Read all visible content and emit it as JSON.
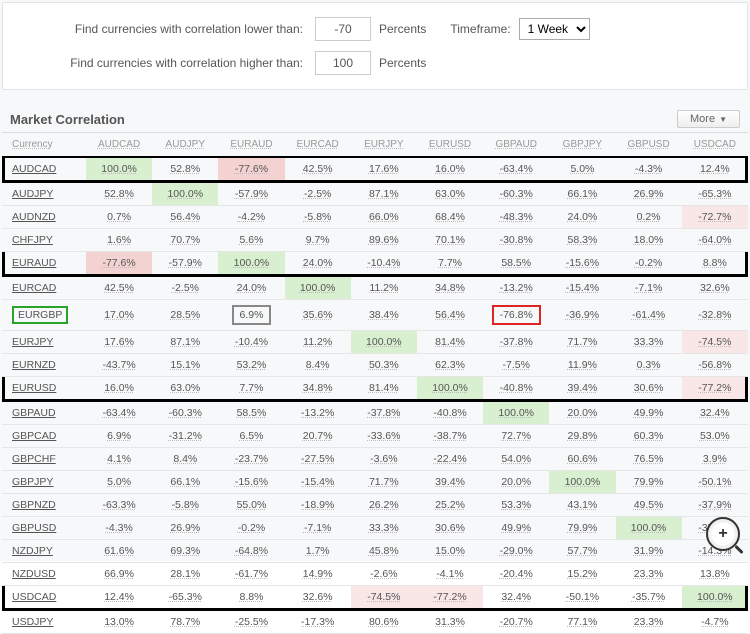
{
  "filters": {
    "lower_label": "Find currencies with correlation lower than:",
    "lower_value": "-70",
    "higher_label": "Find currencies with correlation higher than:",
    "higher_value": "100",
    "percents": "Percents",
    "timeframe_label": "Timeframe:",
    "timeframe_value": "1 Week"
  },
  "section": {
    "title": "Market Correlation",
    "more": "More"
  },
  "columns": [
    "Currency",
    "AUDCAD",
    "AUDJPY",
    "EURAUD",
    "EURCAD",
    "EURJPY",
    "EURUSD",
    "GBPAUD",
    "GBPJPY",
    "GBPUSD",
    "USDCAD"
  ],
  "rows": [
    {
      "sym": "AUDCAD",
      "black_row": true,
      "c": [
        {
          "v": "100.0%",
          "hl": "g"
        },
        {
          "v": "52.8%"
        },
        {
          "v": "-77.6%",
          "hl": "r"
        },
        {
          "v": "42.5%"
        },
        {
          "v": "17.6%"
        },
        {
          "v": "16.0%"
        },
        {
          "v": "-63.4%"
        },
        {
          "v": "5.0%"
        },
        {
          "v": "-4.3%"
        },
        {
          "v": "12.4%"
        }
      ]
    },
    {
      "sym": "AUDJPY",
      "c": [
        {
          "v": "52.8%"
        },
        {
          "v": "100.0%",
          "hl": "g"
        },
        {
          "v": "-57.9%"
        },
        {
          "v": "-2.5%"
        },
        {
          "v": "87.1%"
        },
        {
          "v": "63.0%"
        },
        {
          "v": "-60.3%"
        },
        {
          "v": "66.1%"
        },
        {
          "v": "26.9%"
        },
        {
          "v": "-65.3%"
        }
      ]
    },
    {
      "sym": "AUDNZD",
      "c": [
        {
          "v": "0.7%"
        },
        {
          "v": "56.4%"
        },
        {
          "v": "-4.2%"
        },
        {
          "v": "-5.8%"
        },
        {
          "v": "66.0%"
        },
        {
          "v": "68.4%"
        },
        {
          "v": "-48.3%"
        },
        {
          "v": "24.0%"
        },
        {
          "v": "0.2%"
        },
        {
          "v": "-72.7%",
          "hl": "rl"
        }
      ]
    },
    {
      "sym": "CHFJPY",
      "c": [
        {
          "v": "1.6%"
        },
        {
          "v": "70.7%"
        },
        {
          "v": "5.6%"
        },
        {
          "v": "9.7%"
        },
        {
          "v": "89.6%"
        },
        {
          "v": "70.1%"
        },
        {
          "v": "-30.8%"
        },
        {
          "v": "58.3%"
        },
        {
          "v": "18.0%"
        },
        {
          "v": "-64.0%"
        }
      ]
    },
    {
      "sym": "EURAUD",
      "black_row": true,
      "c": [
        {
          "v": "-77.6%",
          "hl": "r"
        },
        {
          "v": "-57.9%"
        },
        {
          "v": "100.0%",
          "hl": "g"
        },
        {
          "v": "24.0%"
        },
        {
          "v": "-10.4%"
        },
        {
          "v": "7.7%"
        },
        {
          "v": "58.5%"
        },
        {
          "v": "-15.6%"
        },
        {
          "v": "-0.2%"
        },
        {
          "v": "8.8%"
        }
      ]
    },
    {
      "sym": "EURCAD",
      "c": [
        {
          "v": "42.5%"
        },
        {
          "v": "-2.5%"
        },
        {
          "v": "24.0%"
        },
        {
          "v": "100.0%",
          "hl": "g"
        },
        {
          "v": "11.2%"
        },
        {
          "v": "34.8%"
        },
        {
          "v": "-13.2%"
        },
        {
          "v": "-15.4%"
        },
        {
          "v": "-7.1%"
        },
        {
          "v": "32.6%"
        }
      ]
    },
    {
      "sym": "EURGBP",
      "sym_box": "green",
      "c": [
        {
          "v": "17.0%"
        },
        {
          "v": "28.5%"
        },
        {
          "v": "6.9%",
          "box": "gray"
        },
        {
          "v": "35.6%"
        },
        {
          "v": "38.4%"
        },
        {
          "v": "56.4%"
        },
        {
          "v": "-76.8%",
          "box": "red"
        },
        {
          "v": "-36.9%"
        },
        {
          "v": "-61.4%"
        },
        {
          "v": "-32.8%"
        }
      ]
    },
    {
      "sym": "EURJPY",
      "c": [
        {
          "v": "17.6%"
        },
        {
          "v": "87.1%"
        },
        {
          "v": "-10.4%"
        },
        {
          "v": "11.2%"
        },
        {
          "v": "100.0%",
          "hl": "g"
        },
        {
          "v": "81.4%"
        },
        {
          "v": "-37.8%"
        },
        {
          "v": "71.7%"
        },
        {
          "v": "33.3%"
        },
        {
          "v": "-74.5%",
          "hl": "rl"
        }
      ]
    },
    {
      "sym": "EURNZD",
      "c": [
        {
          "v": "-43.7%"
        },
        {
          "v": "15.1%"
        },
        {
          "v": "53.2%"
        },
        {
          "v": "8.4%"
        },
        {
          "v": "50.3%"
        },
        {
          "v": "62.3%"
        },
        {
          "v": "-7.5%"
        },
        {
          "v": "11.9%"
        },
        {
          "v": "0.3%"
        },
        {
          "v": "-56.8%"
        }
      ]
    },
    {
      "sym": "EURUSD",
      "black_row": true,
      "c": [
        {
          "v": "16.0%"
        },
        {
          "v": "63.0%"
        },
        {
          "v": "7.7%"
        },
        {
          "v": "34.8%"
        },
        {
          "v": "81.4%"
        },
        {
          "v": "100.0%",
          "hl": "g"
        },
        {
          "v": "-40.8%"
        },
        {
          "v": "39.4%"
        },
        {
          "v": "30.6%"
        },
        {
          "v": "-77.2%",
          "hl": "rl"
        }
      ]
    },
    {
      "sym": "GBPAUD",
      "c": [
        {
          "v": "-63.4%"
        },
        {
          "v": "-60.3%"
        },
        {
          "v": "58.5%"
        },
        {
          "v": "-13.2%"
        },
        {
          "v": "-37.8%"
        },
        {
          "v": "-40.8%"
        },
        {
          "v": "100.0%",
          "hl": "g"
        },
        {
          "v": "20.0%"
        },
        {
          "v": "49.9%"
        },
        {
          "v": "32.4%"
        }
      ]
    },
    {
      "sym": "GBPCAD",
      "c": [
        {
          "v": "6.9%"
        },
        {
          "v": "-31.2%"
        },
        {
          "v": "6.5%"
        },
        {
          "v": "20.7%"
        },
        {
          "v": "-33.6%"
        },
        {
          "v": "-38.7%"
        },
        {
          "v": "72.7%"
        },
        {
          "v": "29.8%"
        },
        {
          "v": "60.3%"
        },
        {
          "v": "53.0%"
        }
      ]
    },
    {
      "sym": "GBPCHF",
      "c": [
        {
          "v": "4.1%"
        },
        {
          "v": "8.4%"
        },
        {
          "v": "-23.7%"
        },
        {
          "v": "-27.5%"
        },
        {
          "v": "-3.6%"
        },
        {
          "v": "-22.4%"
        },
        {
          "v": "54.0%"
        },
        {
          "v": "60.6%"
        },
        {
          "v": "76.5%"
        },
        {
          "v": "3.9%"
        }
      ]
    },
    {
      "sym": "GBPJPY",
      "c": [
        {
          "v": "5.0%"
        },
        {
          "v": "66.1%"
        },
        {
          "v": "-15.6%"
        },
        {
          "v": "-15.4%"
        },
        {
          "v": "71.7%"
        },
        {
          "v": "39.4%"
        },
        {
          "v": "20.0%"
        },
        {
          "v": "100.0%",
          "hl": "g"
        },
        {
          "v": "79.9%"
        },
        {
          "v": "-50.1%"
        }
      ]
    },
    {
      "sym": "GBPNZD",
      "c": [
        {
          "v": "-63.3%"
        },
        {
          "v": "-5.8%"
        },
        {
          "v": "55.0%"
        },
        {
          "v": "-18.9%"
        },
        {
          "v": "26.2%"
        },
        {
          "v": "25.2%"
        },
        {
          "v": "53.3%"
        },
        {
          "v": "43.1%"
        },
        {
          "v": "49.5%"
        },
        {
          "v": "-37.9%"
        }
      ]
    },
    {
      "sym": "GBPUSD",
      "c": [
        {
          "v": "-4.3%"
        },
        {
          "v": "26.9%"
        },
        {
          "v": "-0.2%"
        },
        {
          "v": "-7.1%"
        },
        {
          "v": "33.3%"
        },
        {
          "v": "30.6%"
        },
        {
          "v": "49.9%"
        },
        {
          "v": "79.9%"
        },
        {
          "v": "100.0%",
          "hl": "g"
        },
        {
          "v": "-35.7%"
        }
      ]
    },
    {
      "sym": "NZDJPY",
      "c": [
        {
          "v": "61.6%"
        },
        {
          "v": "69.3%"
        },
        {
          "v": "-64.8%"
        },
        {
          "v": "1.7%"
        },
        {
          "v": "45.8%"
        },
        {
          "v": "15.0%"
        },
        {
          "v": "-29.0%"
        },
        {
          "v": "57.7%"
        },
        {
          "v": "31.9%"
        },
        {
          "v": "-14.3%"
        }
      ]
    },
    {
      "sym": "NZDUSD",
      "c": [
        {
          "v": "66.9%"
        },
        {
          "v": "28.1%"
        },
        {
          "v": "-61.7%"
        },
        {
          "v": "14.9%"
        },
        {
          "v": "-2.6%"
        },
        {
          "v": "-4.1%"
        },
        {
          "v": "-20.4%"
        },
        {
          "v": "15.2%"
        },
        {
          "v": "23.3%"
        },
        {
          "v": "13.8%"
        }
      ]
    },
    {
      "sym": "USDCAD",
      "black_row": true,
      "c": [
        {
          "v": "12.4%"
        },
        {
          "v": "-65.3%"
        },
        {
          "v": "8.8%"
        },
        {
          "v": "32.6%"
        },
        {
          "v": "-74.5%",
          "hl": "rl"
        },
        {
          "v": "-77.2%",
          "hl": "rl"
        },
        {
          "v": "32.4%"
        },
        {
          "v": "-50.1%"
        },
        {
          "v": "-35.7%"
        },
        {
          "v": "100.0%",
          "hl": "g"
        }
      ]
    },
    {
      "sym": "USDJPY",
      "c": [
        {
          "v": "13.0%"
        },
        {
          "v": "78.7%"
        },
        {
          "v": "-25.5%"
        },
        {
          "v": "-17.3%"
        },
        {
          "v": "80.6%"
        },
        {
          "v": "31.3%"
        },
        {
          "v": "-20.7%"
        },
        {
          "v": "77.1%"
        },
        {
          "v": "23.3%"
        },
        {
          "v": "-4.7%"
        }
      ]
    }
  ],
  "magnify": "+"
}
